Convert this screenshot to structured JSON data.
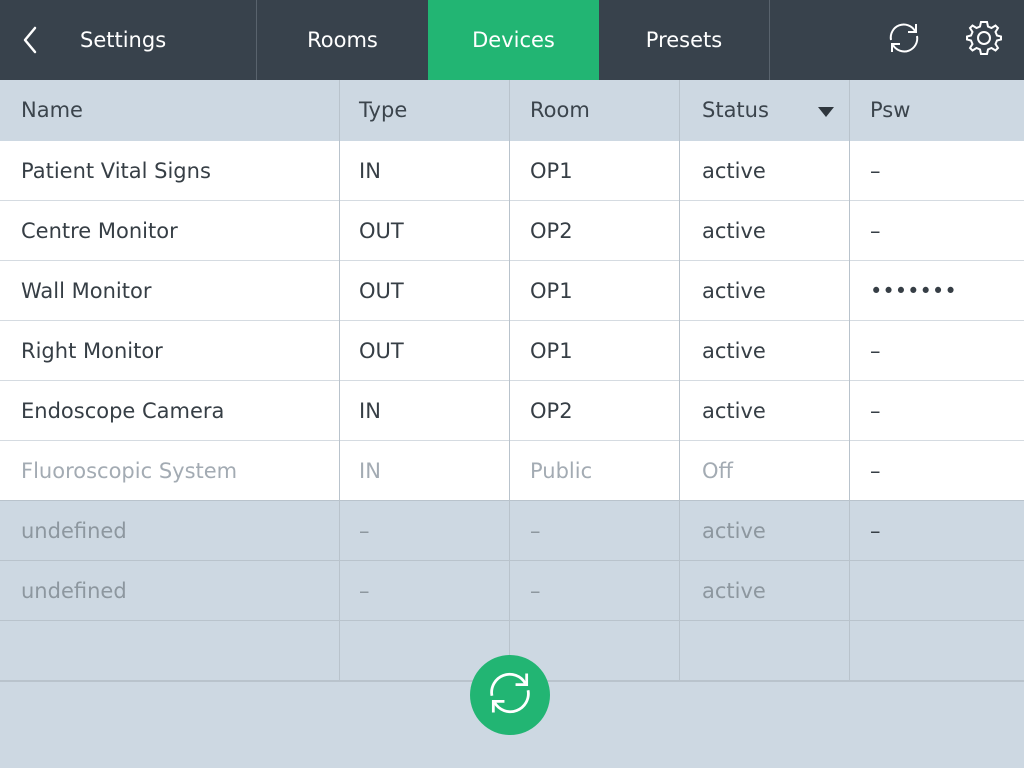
{
  "topbar": {
    "back_label": "Settings",
    "tabs": [
      {
        "label": "Rooms",
        "active": false
      },
      {
        "label": "Devices",
        "active": true
      },
      {
        "label": "Presets",
        "active": false
      }
    ],
    "icons": [
      "chevron-left-icon",
      "sync-icon",
      "gear-icon"
    ],
    "active_color": "#22b573",
    "bar_color": "#38424c"
  },
  "table": {
    "columns": [
      "Name",
      "Type",
      "Room",
      "Status",
      "Psw"
    ],
    "sort_column": "Status",
    "rows": [
      {
        "name": "Patient Vital Signs",
        "type": "IN",
        "room": "OP1",
        "status": "active",
        "psw": "–",
        "style": "normal"
      },
      {
        "name": "Centre Monitor",
        "type": "OUT",
        "room": "OP2",
        "status": "active",
        "psw": "–",
        "style": "normal"
      },
      {
        "name": "Wall Monitor",
        "type": "OUT",
        "room": "OP1",
        "status": "active",
        "psw": "•••••••",
        "style": "normal"
      },
      {
        "name": "Right Monitor",
        "type": "OUT",
        "room": "OP1",
        "status": "active",
        "psw": "–",
        "style": "normal"
      },
      {
        "name": "Endoscope Camera",
        "type": "IN",
        "room": "OP2",
        "status": "active",
        "psw": "–",
        "style": "normal"
      },
      {
        "name": "Fluoroscopic System",
        "type": "IN",
        "room": "Public",
        "status": "Off",
        "psw": "–",
        "style": "muted"
      },
      {
        "name": "undefined",
        "type": "–",
        "room": "–",
        "status": "active",
        "psw": "–",
        "style": "undefined"
      },
      {
        "name": "undefined",
        "type": "–",
        "room": "–",
        "status": "active",
        "psw": "",
        "style": "undefined"
      },
      {
        "name": "",
        "type": "",
        "room": "",
        "status": "",
        "psw": "",
        "style": "empty"
      }
    ]
  },
  "fab": {
    "icon": "sync-icon"
  }
}
